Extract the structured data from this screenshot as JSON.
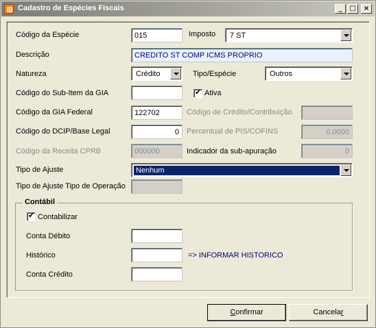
{
  "window": {
    "title": "Cadastro de Espécies Fiscais"
  },
  "titlebar": {
    "minimize": "_",
    "maximize": "□",
    "close": "×"
  },
  "form": {
    "codigo_especie_label": "Código da Espécie",
    "codigo_especie_value": "015",
    "imposto_label": "Imposto",
    "imposto_value": "7 ST",
    "descricao_label": "Descrição",
    "descricao_value": "CREDITO ST COMP ICMS PROPRIO",
    "natureza_label": "Natureza",
    "natureza_value": "Crédito",
    "tipo_especie_label": "Tipo/Espécie",
    "tipo_especie_value": "Outros",
    "subitem_gia_label": "Código do Sub-Item da GIA",
    "subitem_gia_value": "",
    "ativa_label": "Ativa",
    "gia_federal_label": "Código da GIA Federal",
    "gia_federal_value": "122702",
    "credito_contrib_label": "Código de Crédito/Contribuição",
    "credito_contrib_value": "",
    "dcip_label": "Código do DCIP/Base Legal",
    "dcip_value": "0",
    "pis_cofins_label": "Percentual de PIS/COFINS",
    "pis_cofins_value": "0,0000",
    "receita_cprb_label": "Código da Receita CPRB",
    "receita_cprb_value": "000000",
    "sub_apuracao_label": "Indicador da sub-apuração",
    "sub_apuracao_value": "0",
    "tipo_ajuste_label": "Tipo de Ajuste",
    "tipo_ajuste_value": "Nenhum",
    "tipo_ajuste_operacao_label": "Tipo de Ajuste Tipo de Operação",
    "tipo_ajuste_operacao_value": ""
  },
  "contabil": {
    "title": "Contábil",
    "contabilizar_label": "Contabilizar",
    "conta_debito_label": "Conta Débito",
    "conta_debito_value": "",
    "historico_label": "Histórico",
    "historico_value": "",
    "historico_note": "=> INFORMAR HISTORICO",
    "conta_credito_label": "Conta Crédito",
    "conta_credito_value": ""
  },
  "buttons": {
    "confirmar_first": "C",
    "confirmar_rest": "onfirmar",
    "cancelar_first": "Cancela",
    "cancelar_u": "r"
  }
}
